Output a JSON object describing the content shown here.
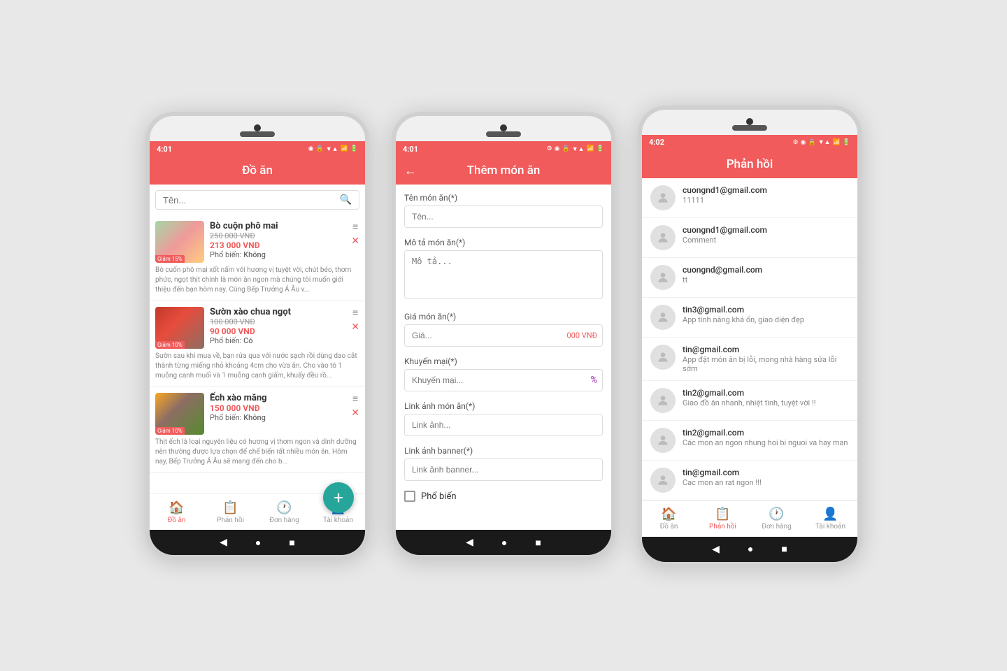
{
  "colors": {
    "primary": "#f15b5b",
    "teal": "#26a69a",
    "purple": "#9c27b0"
  },
  "phone1": {
    "statusBar": {
      "time": "4:01",
      "icons": [
        "◉",
        "🔒",
        "📷",
        "▼▲",
        "📶",
        "🔋"
      ]
    },
    "header": {
      "title": "Đồ ăn"
    },
    "search": {
      "placeholder": "Tên..."
    },
    "foods": [
      {
        "name": "Bò cuộn phô mai",
        "originalPrice": "250 000 VNĐ",
        "price": "213 000 VNĐ",
        "popular": "Không",
        "discount": "Giảm 15%",
        "desc": "Bò cuốn phô mai xốt nấm với hương vị tuyệt vời, chút béo, thơm phức, ngọt thịt chính là món ăn ngon mà chúng tôi muốn giới thiệu đến bạn hôm nay. Cùng Bếp Trưởng Á Âu v...",
        "imgType": "beef"
      },
      {
        "name": "Sườn xào chua ngọt",
        "originalPrice": "100 000 VNĐ",
        "price": "90 000 VNĐ",
        "popular": "Có",
        "discount": "Giảm 10%",
        "desc": "Sườn sau khi mua về, bạn rửa qua với nước sạch rồi dùng dao cắt thành từng miếng nhỏ khoảng 4cm cho vừa ăn. Cho vào tô 1 muỗng canh muối và 1 muỗng canh giấm, khuấy đều rồ...",
        "imgType": "sour"
      },
      {
        "name": "Ếch xào măng",
        "originalPrice": "",
        "price": "150 000 VNĐ",
        "popular": "Không",
        "discount": "Giảm 10%",
        "desc": "Thịt ếch là loại nguyên liệu có hương vị thơm ngon và dinh dưỡng nên thường được lựa chọn để chế biến rất nhiều món ăn. Hôm nay, Bếp Trưởng Á Âu sẽ mang đến cho b...",
        "imgType": "frog"
      }
    ],
    "nav": [
      {
        "label": "Đồ ăn",
        "icon": "🏠",
        "active": true
      },
      {
        "label": "Phản hồi",
        "icon": "📋",
        "active": false
      },
      {
        "label": "Đơn hàng",
        "icon": "🕐",
        "active": false
      },
      {
        "label": "Tài khoản",
        "icon": "👤",
        "active": false
      }
    ]
  },
  "phone2": {
    "statusBar": {
      "time": "4:01"
    },
    "header": {
      "title": "Thêm món ăn",
      "back": "←"
    },
    "form": {
      "fields": [
        {
          "label": "Tên món ăn(*)",
          "placeholder": "Tên...",
          "type": "text"
        },
        {
          "label": "Mô tả món ăn(*)",
          "placeholder": "Mô tả...",
          "type": "textarea"
        },
        {
          "label": "Giá món ăn(*)",
          "placeholder": "Giá...",
          "type": "price",
          "suffix": "000 VNĐ"
        },
        {
          "label": "Khuyến mại(*)",
          "placeholder": "Khuyến mại...",
          "type": "promo",
          "suffix": "%"
        },
        {
          "label": "Link ảnh món ăn(*)",
          "placeholder": "Link ảnh...",
          "type": "text"
        },
        {
          "label": "Link ảnh banner(*)",
          "placeholder": "Link ảnh banner...",
          "type": "text"
        }
      ],
      "checkbox": {
        "label": "Phổ biến"
      }
    }
  },
  "phone3": {
    "statusBar": {
      "time": "4:02"
    },
    "header": {
      "title": "Phản hồi"
    },
    "feedbacks": [
      {
        "email": "cuongnd1@gmail.com",
        "text": "11111"
      },
      {
        "email": "cuongnd1@gmail.com",
        "text": "Comment"
      },
      {
        "email": "cuongnd@gmail.com",
        "text": "tt"
      },
      {
        "email": "tin3@gmail.com",
        "text": "App tính năng khá ổn, giao diện đẹp"
      },
      {
        "email": "tin@gmail.com",
        "text": "App đặt món ăn bị lỗi, mong nhà hàng sửa lỗi sớm"
      },
      {
        "email": "tin2@gmail.com",
        "text": "Giao đồ ăn nhanh, nhiệt tình, tuyệt vời !!"
      },
      {
        "email": "tin2@gmail.com",
        "text": "Các mon an ngon nhung hoi bi nguoi va hay man"
      },
      {
        "email": "tin@gmail.com",
        "text": "Cac mon an rat ngon !!!"
      }
    ],
    "nav": [
      {
        "label": "Đồ ăn",
        "icon": "🏠",
        "active": false
      },
      {
        "label": "Phản hồi",
        "icon": "📋",
        "active": true
      },
      {
        "label": "Đơn hàng",
        "icon": "🕐",
        "active": false
      },
      {
        "label": "Tài khoản",
        "icon": "👤",
        "active": false
      }
    ]
  }
}
